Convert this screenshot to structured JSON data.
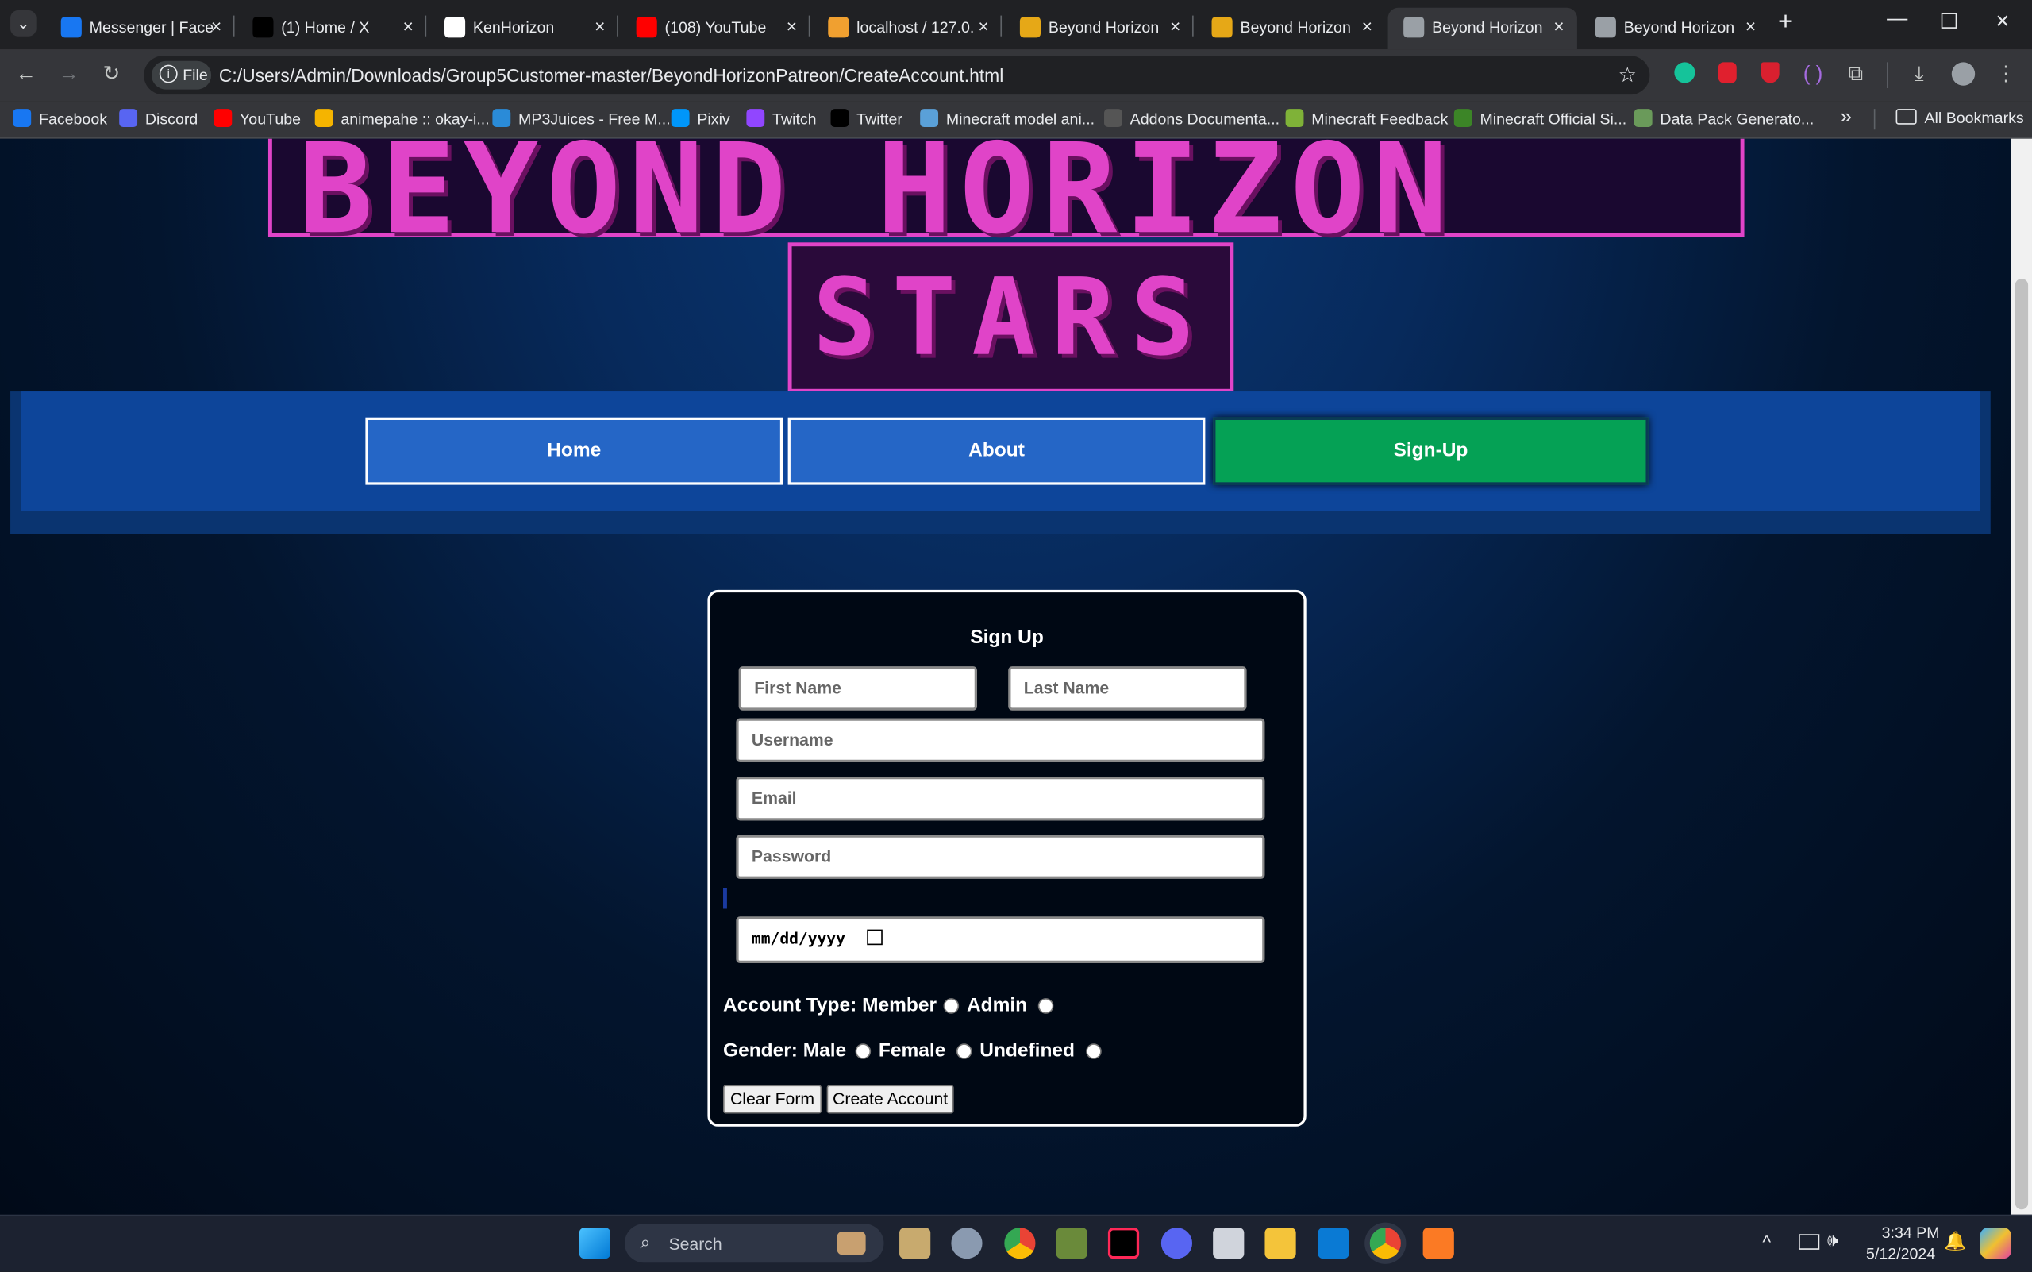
{
  "browser": {
    "tabs": [
      {
        "title": "Messenger | Face",
        "color": "#1877f2"
      },
      {
        "title": "(1) Home / X",
        "color": "#000000"
      },
      {
        "title": "KenHorizon",
        "color": "#ffffff"
      },
      {
        "title": "(108) YouTube",
        "color": "#ff0000"
      },
      {
        "title": "localhost / 127.0.",
        "color": "#f0a030"
      },
      {
        "title": "Beyond Horizon",
        "color": "#e6a817"
      },
      {
        "title": "Beyond Horizon",
        "color": "#e6a817"
      },
      {
        "title": "Beyond Horizon",
        "color": "#9aa0a6"
      },
      {
        "title": "Beyond Horizon",
        "color": "#9aa0a6"
      }
    ],
    "new_tab": "+",
    "close_glyph": "×",
    "address_chip": "File",
    "url": "C:/Users/Admin/Downloads/Group5Customer-master/BeyondHorizonPatreon/CreateAccount.html",
    "bookmarks": [
      {
        "label": "Facebook",
        "color": "#1877f2"
      },
      {
        "label": "Discord",
        "color": "#5865f2"
      },
      {
        "label": "YouTube",
        "color": "#ff0000"
      },
      {
        "label": "animepahe :: okay-i...",
        "color": "#f5b400"
      },
      {
        "label": "MP3Juices - Free M...",
        "color": "#2a8bd8"
      },
      {
        "label": "Pixiv",
        "color": "#0096fa"
      },
      {
        "label": "Twitch",
        "color": "#9146ff"
      },
      {
        "label": "Twitter",
        "color": "#000000"
      },
      {
        "label": "Minecraft model ani...",
        "color": "#5aa0d8"
      },
      {
        "label": "Addons Documenta...",
        "color": "#555555"
      },
      {
        "label": "Minecraft Feedback",
        "color": "#7fb238"
      },
      {
        "label": "Minecraft Official Si...",
        "color": "#3c8527"
      },
      {
        "label": "Data Pack Generato...",
        "color": "#6a9a5a"
      }
    ],
    "all_bookmarks": "All Bookmarks",
    "overflow": "»"
  },
  "page": {
    "banner_bottom_text": "STARS",
    "banner_top_text": "BEYOND HORIZON",
    "nav": {
      "home": "Home",
      "about": "About",
      "signup": "Sign-Up"
    },
    "form": {
      "title": "Sign Up",
      "first_name_placeholder": "First Name",
      "last_name_placeholder": "Last Name",
      "username_placeholder": "Username",
      "email_placeholder": "Email",
      "password_placeholder": "Password",
      "date_value": "mm/dd/yyyy",
      "account_type_label": "Account Type:",
      "account_member": "Member",
      "account_admin": "Admin",
      "gender_label": "Gender:",
      "gender_male": "Male",
      "gender_female": "Female",
      "gender_undefined": "Undefined",
      "clear_button": "Clear Form",
      "create_button": "Create Account"
    }
  },
  "taskbar": {
    "search": "Search",
    "time": "3:34 PM",
    "date": "5/12/2024"
  },
  "colors": {
    "accent_pink": "#e044c8",
    "nav_blue": "#2566c6",
    "signup_green": "#05a155"
  }
}
